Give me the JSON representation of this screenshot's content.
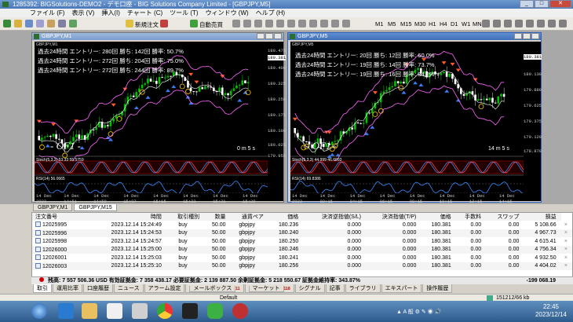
{
  "app": {
    "title": "1285392: BIGSolutions-DEMO2 - デモ口座 - BIG Solutions Company Limited - [GBPJPY,M5]"
  },
  "menu": [
    "ファイル (F)",
    "表示 (V)",
    "挿入(I)",
    "チャート (C)",
    "ツール (T)",
    "ウィンドウ (W)",
    "ヘルプ (H)"
  ],
  "toolbar": {
    "new_order": "新規注文",
    "auto_trade": "自動売買",
    "timeframes": [
      "M1",
      "M5",
      "M15",
      "M30",
      "H1",
      "H4",
      "D1",
      "W1",
      "MN"
    ]
  },
  "chart1": {
    "title": "GBPJPY,M1",
    "subtitle": "GBPJPY,M1",
    "info": [
      "過去24時間  エントリー: 280回   勝ち: 142回   勝率: 50.7%",
      "過去24時間  エントリー: 272回   勝ち: 204回   勝率: 75.0%",
      "過去24時間  エントリー: 272回   勝ち: 244回   勝率: 89.7%"
    ],
    "brand": "- OF1 -",
    "timer": "0 m 5 s",
    "stoch_label": "Stoch(5,3,3) 53.33 55.5759",
    "rsi_label": "RSI(14) 56.0665",
    "price_axis": [
      "180.475",
      "180.400",
      "180.325",
      "180.250",
      "180.175",
      "180.100",
      "180.025",
      "179.955"
    ],
    "time_axis": [
      "14 Dec 2023",
      "14 Dec 14:51",
      "14 Dec 14:59",
      "14 Dec 15:07",
      "14 Dec 15:15",
      "14 Dec 15:23",
      "14 Dec 15:31",
      "14 Dec 15:39"
    ],
    "current_price": "180.381"
  },
  "chart2": {
    "title": "GBPJPY,M5",
    "subtitle": "GBPJPY,M5",
    "info": [
      "過去24時間  エントリー: 20回   勝ち: 12回   勝率: 60.0%",
      "過去24時間  エントリー: 19回   勝ち: 14回   勝率: 73.7%",
      "過去24時間  エントリー: 19回   勝ち: 16回   勝率: 84.2%"
    ],
    "brand": "- OF1 -",
    "timer": "14 m 5 s",
    "stoch_label": "Stoch(5,3,3) 44.999 46.6993",
    "rsi_label": "RSI(14) 69.8386",
    "price_axis": [
      "180.381",
      "180.130",
      "179.880",
      "179.625",
      "179.375",
      "179.120",
      "178.870"
    ],
    "time_axis": [
      "14 Dec 2023",
      "14 Dec 02:15",
      "14 Dec 04:15",
      "14 Dec 06:15",
      "14 Dec 08:15",
      "14 Dec 10:15",
      "14 Dec 12:15",
      "14 Dec 14:15"
    ]
  },
  "chart_tabs": [
    "GBPJPY,M1",
    "GBPJPY,M15"
  ],
  "terminal": {
    "columns": [
      "注文番号",
      "時間",
      "取引種別",
      "数量",
      "通貨ペア",
      "価格",
      "決済逆指値(S/L)",
      "決済指値(T/P)",
      "価格",
      "手数料",
      "スワップ",
      "損益"
    ],
    "rows": [
      [
        "12025995",
        "2023.12.14 15:24:49",
        "buy",
        "50.00",
        "gbpjpy",
        "180.236",
        "0.000",
        "0.000",
        "180.381",
        "0.00",
        "0.00",
        "5 108.66"
      ],
      [
        "12025996",
        "2023.12.14 15:24:53",
        "buy",
        "50.00",
        "gbpjpy",
        "180.240",
        "0.000",
        "0.000",
        "180.381",
        "0.00",
        "0.00",
        "4 967.73"
      ],
      [
        "12025998",
        "2023.12.14 15:24:57",
        "buy",
        "50.00",
        "gbpjpy",
        "180.250",
        "0.000",
        "0.000",
        "180.381",
        "0.00",
        "0.00",
        "4 615.41"
      ],
      [
        "12026000",
        "2023.12.14 15:25:00",
        "buy",
        "50.00",
        "gbpjpy",
        "180.246",
        "0.000",
        "0.000",
        "180.381",
        "0.00",
        "0.00",
        "4 756.34"
      ],
      [
        "12026001",
        "2023.12.14 15:25:03",
        "buy",
        "50.00",
        "gbpjpy",
        "180.241",
        "0.000",
        "0.000",
        "180.381",
        "0.00",
        "0.00",
        "4 932.50"
      ],
      [
        "12026003",
        "2023.12.14 15:25:10",
        "buy",
        "50.00",
        "gbpjpy",
        "180.256",
        "0.000",
        "0.000",
        "180.381",
        "0.00",
        "0.00",
        "4 404.02"
      ]
    ],
    "balance_line": "残高: 7 557 506.36 USD  有効証拠金: 7 358 438.17  必要証拠金: 2 139 887.50  余剰証拠金: 5 218 550.67  証拠金維持率: 343.87%",
    "total": "-199 068.19",
    "tabs": [
      "取引",
      "運用比率",
      "口座履歴",
      "ニュース",
      "アラーム設定",
      "メールボックス",
      "マーケット",
      "シグナル",
      "記事",
      "ライブラリ",
      "エキスパート",
      "操作履歴"
    ],
    "mailbox_badge": "11",
    "market_badge": "118"
  },
  "status": {
    "profile": "Default",
    "traffic": "151212/66 kb"
  },
  "taskbar": {
    "time": "22:45",
    "date": "2023/12/14"
  },
  "colors": {
    "bull_candle": "#00c000",
    "bear_candle": "#ffffff",
    "band": "#ff66ff",
    "ma": "#ffff66"
  }
}
